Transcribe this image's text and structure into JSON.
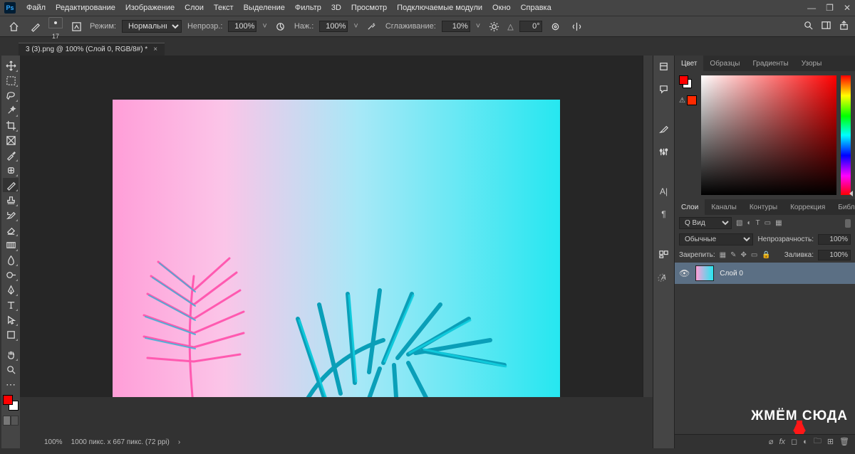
{
  "menubar": {
    "items": [
      "Файл",
      "Редактирование",
      "Изображение",
      "Слои",
      "Текст",
      "Выделение",
      "Фильтр",
      "3D",
      "Просмотр",
      "Подключаемые модули",
      "Окно",
      "Справка"
    ]
  },
  "options": {
    "brush_size": "17",
    "mode_label": "Режим:",
    "mode_value": "Нормальный",
    "opacity_label": "Непрозр.:",
    "opacity_value": "100%",
    "flow_label": "Наж.:",
    "flow_value": "100%",
    "smooth_label": "Сглаживание:",
    "smooth_value": "10%",
    "angle_label": "△",
    "angle_value": "0°"
  },
  "tab": {
    "title": "3 (3).png @ 100% (Слой 0, RGB/8#) *"
  },
  "status": {
    "zoom": "100%",
    "info": "1000 пикс. x 667 пикс. (72 ppi)"
  },
  "color_panel": {
    "tabs": [
      "Цвет",
      "Образцы",
      "Градиенты",
      "Узоры"
    ],
    "fg": "#ff0000",
    "bg": "#ffffff",
    "warn": "#ff2a00"
  },
  "layers_panel": {
    "tabs": [
      "Слои",
      "Каналы",
      "Контуры",
      "Коррекция",
      "Библиотеки"
    ],
    "filter_label": "Q Вид",
    "blend": "Обычные",
    "opacity_label": "Непрозрачность:",
    "opacity_value": "100%",
    "lock_label": "Закрепить:",
    "fill_label": "Заливка:",
    "fill_value": "100%",
    "layer0": "Слой 0"
  },
  "swatch": {
    "fg": "#ff0000",
    "bg": "#ffffff"
  },
  "callout": "ЖМЁМ СЮДА"
}
